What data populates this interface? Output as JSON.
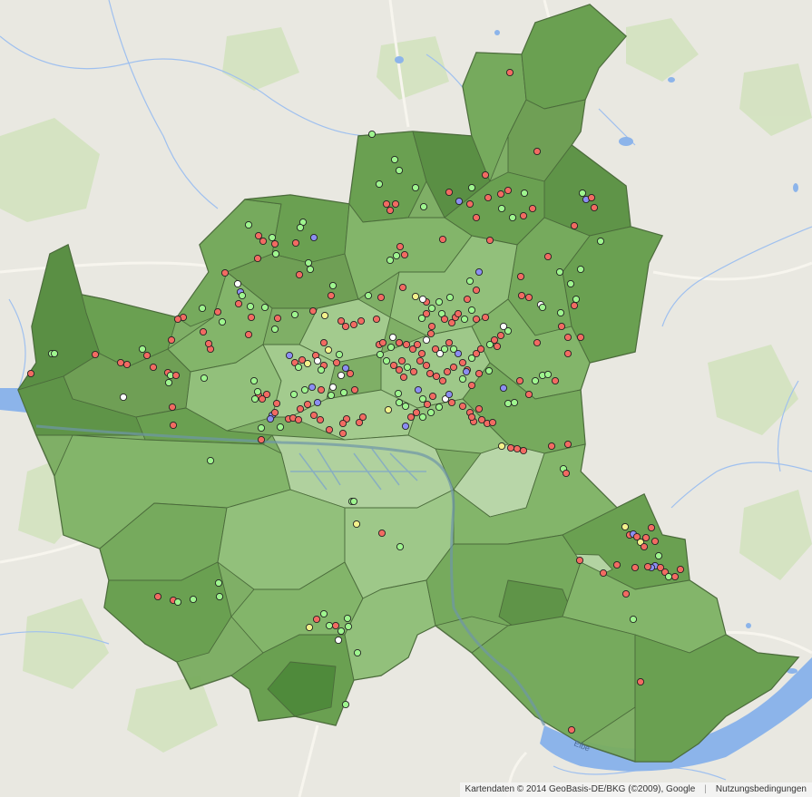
{
  "map": {
    "attribution": "Kartendaten © 2014 GeoBasis-DE/BKG (©2009), Google",
    "terms_link": "Nutzungsbedingungen",
    "river_label": "Elbe",
    "colors": {
      "land": "#e9e8e1",
      "water": "#8cb4ea",
      "stream": "#9fc0ef",
      "park": "#cfdfb9",
      "road": "#f6f4ec",
      "district_border": "#4b6b3b",
      "green_shades": [
        "#5f9448",
        "#6aa051",
        "#76aa5d",
        "#83b56a",
        "#92c07b",
        "#a3cb8e"
      ],
      "marker_red": "#f26b62",
      "marker_green": "#9ff58f",
      "marker_white": "#ffffff",
      "marker_blue": "#8c8ef2",
      "marker_yellow": "#f3f28c",
      "marker_outline": "#222222"
    }
  }
}
